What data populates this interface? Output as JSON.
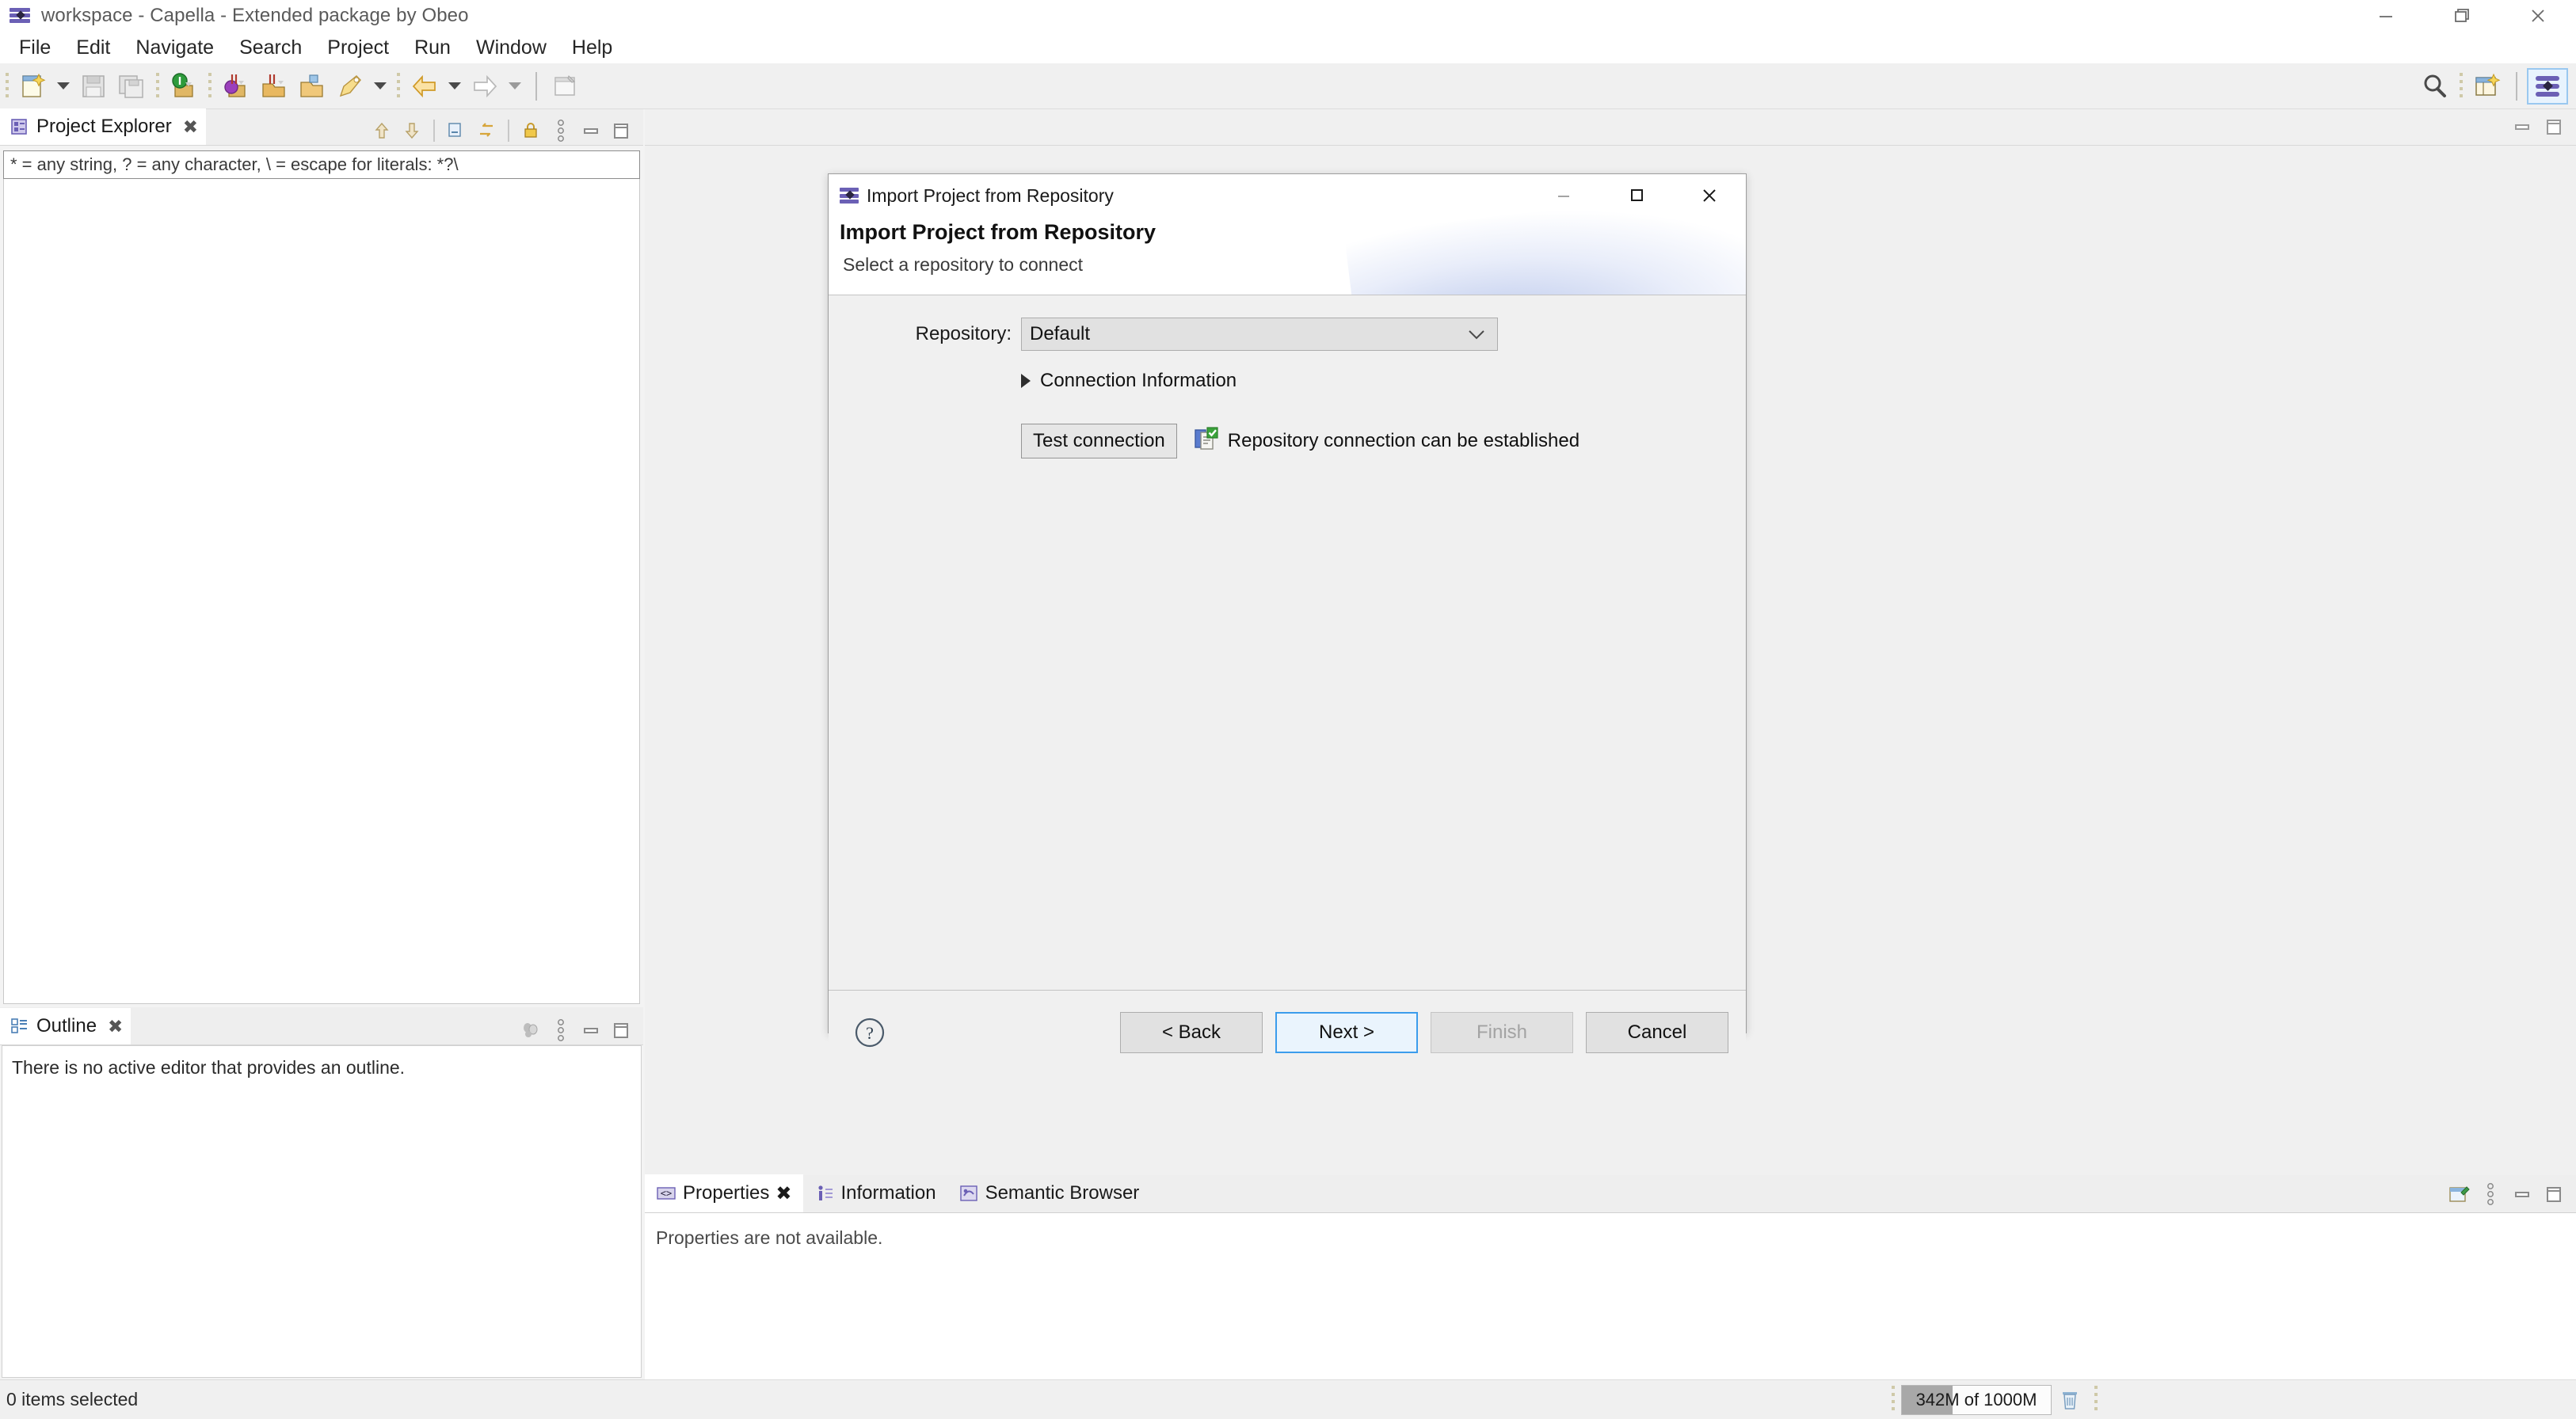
{
  "window": {
    "title": "workspace - Capella - Extended package by Obeo",
    "app_icon": "capella-icon",
    "controls": {
      "minimize": "minimize-icon",
      "restore": "restore-icon",
      "close": "close-icon"
    }
  },
  "menubar": {
    "items": [
      "File",
      "Edit",
      "Navigate",
      "Search",
      "Project",
      "Run",
      "Window",
      "Help"
    ]
  },
  "toolbar": {
    "icons": [
      "new-wizard-icon",
      "new-dropdown-arrow",
      "save-icon",
      "save-all-icon",
      "open-session-icon",
      "close-session-icon",
      "open-model-icon",
      "open-project-icon",
      "validate-icon",
      "validate-dropdown-arrow",
      "back-arrow-icon",
      "back-dropdown-arrow",
      "forward-arrow-icon",
      "forward-dropdown-arrow",
      "open-editor-icon"
    ],
    "right_icons": [
      "search-icon",
      "perspective-open-icon",
      "capella-perspective-icon"
    ]
  },
  "project_explorer": {
    "tab_label": "Project Explorer",
    "close_icon": "close-tab-icon",
    "filter_hint": "* = any string, ? = any character, \\ = escape for literals: *?\\",
    "tools": [
      "collapse-up-icon",
      "expand-down-icon",
      "collapse-all-icon",
      "link-with-editor-icon",
      "lock-icon",
      "view-menu-icon",
      "minimize-icon",
      "maximize-icon"
    ]
  },
  "outline": {
    "tab_label": "Outline",
    "close_icon": "close-tab-icon",
    "message": "There is no active editor that provides an outline.",
    "tools": [
      "hide-icon",
      "view-menu-icon",
      "minimize-icon",
      "maximize-icon"
    ]
  },
  "editor_area": {
    "tools": [
      "minimize-icon",
      "maximize-icon"
    ]
  },
  "properties_panel": {
    "tabs": [
      {
        "label": "Properties",
        "icon": "properties-icon",
        "active": true,
        "closable": true
      },
      {
        "label": "Information",
        "icon": "information-icon",
        "active": false,
        "closable": false
      },
      {
        "label": "Semantic Browser",
        "icon": "semantic-browser-icon",
        "active": false,
        "closable": false
      }
    ],
    "close_icon": "close-tab-icon",
    "message": "Properties are not available.",
    "tools": [
      "pin-editor-icon",
      "view-menu-icon",
      "minimize-icon",
      "maximize-icon"
    ]
  },
  "statusbar": {
    "selection_text": "0 items selected",
    "memory": {
      "label": "342M of 1000M",
      "used_mb": 342,
      "total_mb": 1000,
      "fill_percent": 34.2,
      "trash_icon": "garbage-collect-icon"
    }
  },
  "dialog": {
    "window_title": "Import Project from Repository",
    "icon": "capella-icon",
    "heading": "Import Project from Repository",
    "subtitle": "Select a repository to connect",
    "controls": {
      "minimize": "minimize-icon",
      "maximize": "maximize-icon",
      "close": "close-icon"
    },
    "form": {
      "repository_label": "Repository:",
      "repository_value": "Default",
      "repository_options": [
        "Default"
      ],
      "dropdown_icon": "chevron-down-icon",
      "connection_section_label": "Connection Information",
      "connection_section_expanded": false,
      "twisty_icon": "triangle-right-icon",
      "test_button_label": "Test connection",
      "status_icon": "repository-ok-icon",
      "status_message": "Repository connection can be established"
    },
    "footer": {
      "help_icon": "help-icon",
      "back_label": "< Back",
      "next_label": "Next >",
      "finish_label": "Finish",
      "cancel_label": "Cancel",
      "next_is_default": true,
      "finish_enabled": false
    }
  },
  "colors": {
    "accent_blue": "#3b9cec",
    "accent_blue_bg": "#eaf4fd",
    "capella_purple": "#6b60b5",
    "chrome_bg": "#f0f0f0",
    "status_green": "#3aa33a"
  }
}
